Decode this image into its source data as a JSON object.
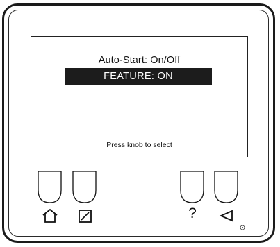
{
  "screen": {
    "title": "Auto-Start: On/Off",
    "selected_option": "FEATURE: ON",
    "hint": "Press knob to select"
  },
  "keys": {
    "help_glyph": "?"
  },
  "icons": {
    "home": "home-icon",
    "edit": "edit-icon",
    "help": "help-icon",
    "back": "back-icon",
    "brand": "brand-mark-icon"
  }
}
